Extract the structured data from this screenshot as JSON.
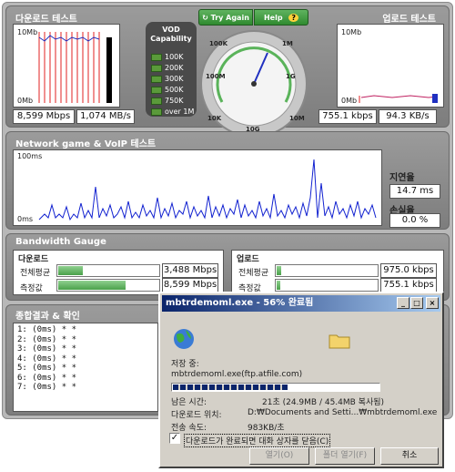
{
  "download_test": {
    "title": "다운로드 테스트",
    "axis_top": "10Mb",
    "axis_bottom": "0Mb",
    "speed": "8,599 Mbps",
    "rate": "1,074 MB/s"
  },
  "upload_test": {
    "title": "업로드 테스트",
    "axis_top": "10Mb",
    "axis_bottom": "0Mb",
    "speed": "755.1 kbps",
    "rate": "94.3 KB/s"
  },
  "vod": {
    "title_line1": "VOD",
    "title_line2": "Capability",
    "levels": [
      "100K",
      "200K",
      "300K",
      "500K",
      "750K",
      "over 1M"
    ]
  },
  "gauge": {
    "try_again": "Try Again",
    "help": "Help",
    "help_icon": "?",
    "try_icon": "↻",
    "scale": [
      "10K",
      "100K",
      "1M",
      "10M",
      "100M",
      "1G",
      "10G"
    ]
  },
  "network": {
    "title": "Network game & VoIP 테스트",
    "axis_top": "100ms",
    "axis_bottom": "0ms",
    "latency_label": "지연율",
    "latency_value": "14.7 ms",
    "loss_label": "손실율",
    "loss_value": "0.0 %"
  },
  "bandwidth": {
    "title": "Bandwidth Gauge",
    "download": {
      "label": "다운로드",
      "rows": [
        {
          "name": "전체평균",
          "value": "3,488 Mbps",
          "fill": 0.26
        },
        {
          "name": "측정값",
          "value": "8,599 Mbps",
          "fill": 0.68
        }
      ]
    },
    "upload": {
      "label": "업로드",
      "rows": [
        {
          "name": "전체평균",
          "value": "975.0 kbps",
          "fill": 0.06
        },
        {
          "name": "측정값",
          "value": "755.1 kbps",
          "fill": 0.05
        }
      ]
    }
  },
  "summary": {
    "title": "종합결과 & 확인",
    "rows": [
      "1:  (0ms) * *",
      "2:  (0ms) * *",
      "3:  (0ms) * *",
      "4:  (0ms) * *",
      "5:  (0ms) * *",
      "6:  (0ms) * *",
      "7:  (0ms) * *"
    ]
  },
  "dialog": {
    "title": "mbtrdemoml.exe - 56% 완료됨",
    "saving_label": "저장 중:",
    "saving_value": "mbtrdemoml.exe(ftp.atfile.com)",
    "progress": 0.56,
    "remaining_label": "남은 시간:",
    "remaining_value": "21초 (24.9MB / 45.4MB 복사됨)",
    "location_label": "다운로드 위치:",
    "location_value": "D:₩Documents and Setti...₩mbtrdemoml.exe",
    "speed_label": "전송 속도:",
    "speed_value": "983KB/초",
    "checkbox_label": "다운로드가 완료되면 대화 상자를 닫음(C)",
    "checkbox_checked": true,
    "buttons": [
      "열기(O)",
      "폴더 열기(F)",
      "취소"
    ],
    "title_buttons": [
      "_",
      "□",
      "×"
    ]
  }
}
